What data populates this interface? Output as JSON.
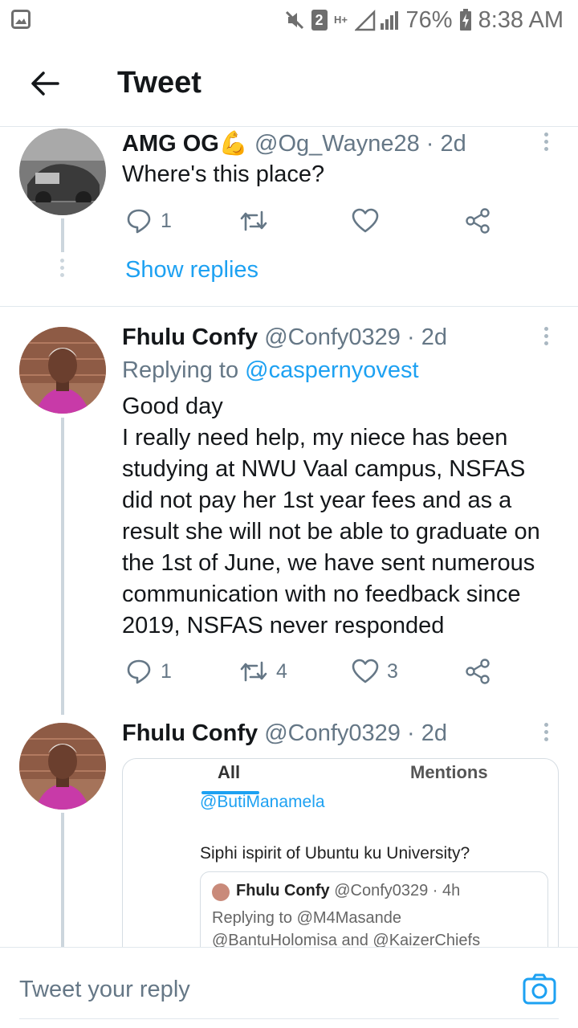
{
  "status_bar": {
    "battery": "76%",
    "time": "8:38 AM",
    "network": "H+",
    "sim_badge": "2"
  },
  "header": {
    "title": "Tweet"
  },
  "tweets": [
    {
      "name": "AMG OG",
      "name_emoji": "💪",
      "handle": "@Og_Wayne28",
      "time": "· 2d",
      "text": "Where's this place?",
      "reply_count": "1",
      "retweet_count": "",
      "like_count": ""
    },
    {
      "name": "Fhulu Confy",
      "handle": "@Confy0329",
      "time": "· 2d",
      "replying_prefix": "Replying to",
      "replying_to": "@caspernyovest",
      "text": "Good day\nI really need help, my niece has been studying at NWU Vaal campus, NSFAS did not pay her 1st year fees and as a result she will not be able to graduate on the 1st of June, we have sent numerous communication with no feedback since 2019, NSFAS never responded",
      "reply_count": "1",
      "retweet_count": "4",
      "like_count": "3"
    },
    {
      "name": "Fhulu Confy",
      "handle": "@Confy0329",
      "time": "· 2d"
    }
  ],
  "show_replies": "Show replies",
  "media": {
    "tab_all": "All",
    "tab_mentions": "Mentions",
    "mention": "@ButiManamela",
    "question": "Siphi ispirit of Ubuntu ku University?",
    "quote_name": "Fhulu Confy",
    "quote_handle": "@Confy0329 · 4h",
    "quote_replying": "Replying to @M4Masande",
    "quote_replying2": "@BantuHolomisa and @KaizerChiefs"
  },
  "reply_bar": {
    "placeholder": "Tweet your reply"
  },
  "colors": {
    "accent": "#1da1f2",
    "secondary_text": "#657786",
    "divider": "#e1e8ed"
  },
  "icons": {
    "back": "arrow-left-icon",
    "reply": "reply-icon",
    "retweet": "retweet-icon",
    "like": "heart-icon",
    "share": "share-icon",
    "more": "more-vertical-icon",
    "camera": "camera-icon"
  }
}
